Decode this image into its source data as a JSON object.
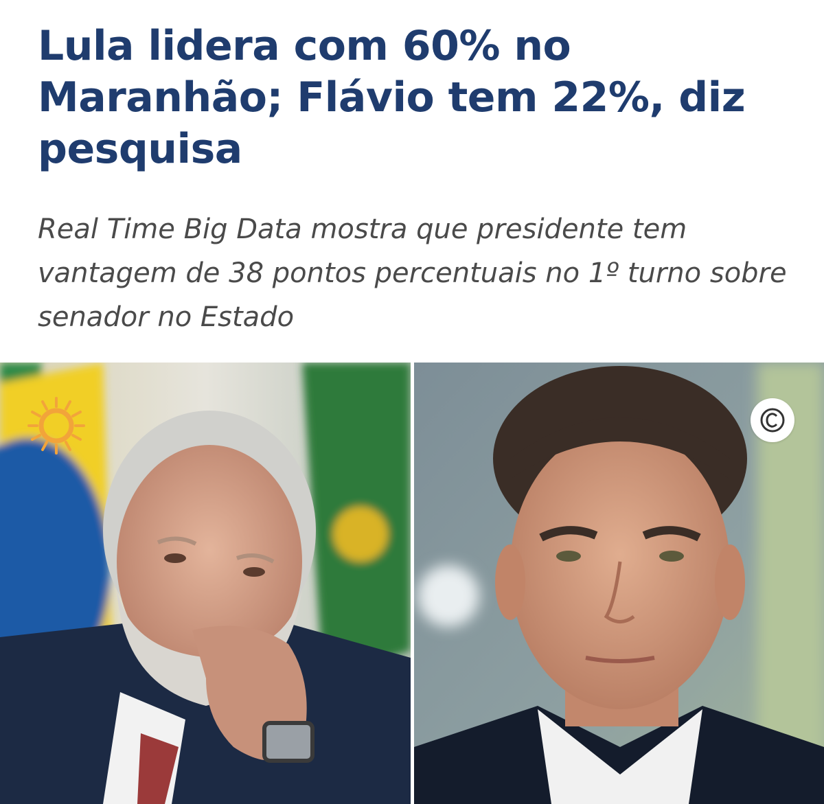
{
  "article": {
    "headline": "Lula lidera com 60% no Maranhão; Flávio tem 22%, diz pesquisa",
    "subheadline": "Real Time Big Data mostra que presidente tem vantagem de 38 pontos percentuais no 1º turno sobre senador no Estado"
  },
  "photos": {
    "left": {
      "subject": "portrait-man-white-beard-hand-on-chin",
      "background": "flag-yellow-green-blue"
    },
    "right": {
      "subject": "portrait-man-dark-hair-dark-suit",
      "background": "blurred-grey-green",
      "badge": "copyright-icon"
    }
  },
  "colors": {
    "headline": "#1f3c6e",
    "subheadline": "#4a4a4a"
  }
}
